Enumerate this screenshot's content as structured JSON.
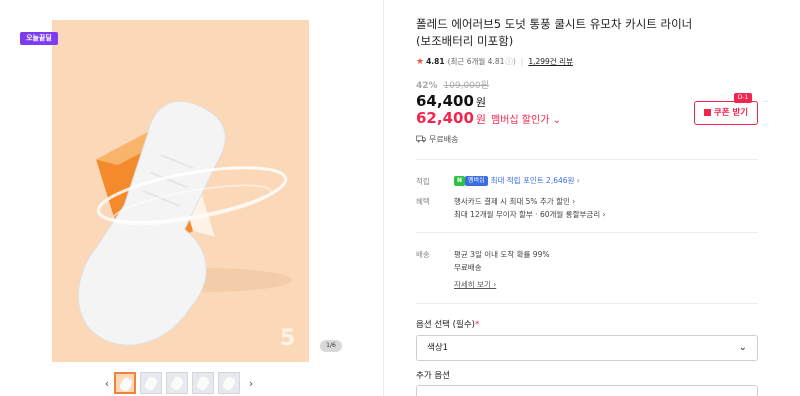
{
  "badge": {
    "today": "오늘끝딜"
  },
  "gallery": {
    "page_indicator": "1/6",
    "hero_number": "5",
    "thumbnails_count": 5
  },
  "product": {
    "title_line1": "폴레드 에어러브5 도넛 통풍 쿨시트 유모차 카시트 라이너",
    "title_line2": "(보조배터리 미포함)",
    "rating": "4.81",
    "rating_note": "(최근 6개월 4.81",
    "review_link": "1,299건 리뷰",
    "discount_rate": "42%",
    "original_price": "109,000원",
    "price": "64,400",
    "price_unit": "원",
    "member_price": "62,400",
    "member_unit": "원",
    "member_label": "멤버십 할인가 ⌄",
    "coupon_label": "쿠폰 받기",
    "coupon_tag": "D-1",
    "shipping_free": "무료배송"
  },
  "benefits": {
    "point_label": "적립",
    "npay_badge": "N",
    "npay_badge2": "멤버십",
    "point_text": "최대 적립 포인트 2,646원 ›",
    "benefit_label": "혜택",
    "benefit_line1": "행사카드 결제 시 최대 5% 추가 할인 ›",
    "benefit_line2": "최대 12개월 무이자 할부 · 60개월 롱할부금리 ›"
  },
  "delivery": {
    "label": "배송",
    "line1": "평균 3일 이내 도착 확률 99%",
    "line2": "무료배송",
    "detail_link": "자세히 보기 ›"
  },
  "options": {
    "select_label": "옵션 선택 (필수)",
    "required_mark": "*",
    "selected_value": "색상1",
    "additional_label": "추가 옵션"
  },
  "colors": {
    "accent_red": "#f2254e",
    "badge_purple": "#7d3cf0",
    "hero_bg": "#fbd8b7"
  }
}
